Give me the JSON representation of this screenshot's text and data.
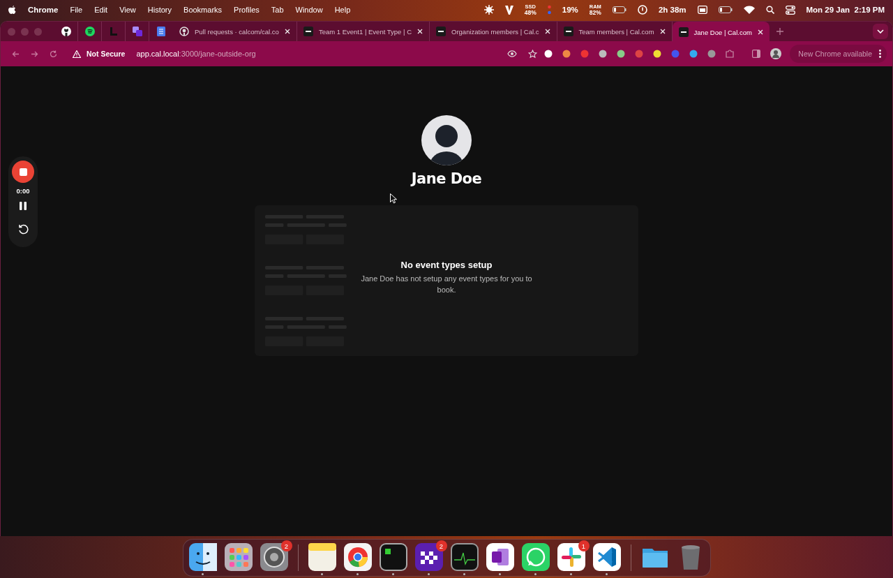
{
  "menubar": {
    "app": "Chrome",
    "menus": [
      "File",
      "Edit",
      "View",
      "History",
      "Bookmarks",
      "Profiles",
      "Tab",
      "Window",
      "Help"
    ],
    "ssd_label": "SSD",
    "ssd": "48%",
    "cpu": "19%",
    "ram_label": "RAM",
    "ram": "82%",
    "battery_time": "2h 38m",
    "clock": "Mon 29 Jan  2:19 PM"
  },
  "tabs": [
    {
      "kind": "pinned",
      "selected": false
    },
    {
      "kind": "pinned",
      "selected": false
    },
    {
      "kind": "pinned",
      "selected": false
    },
    {
      "kind": "pinned",
      "selected": false
    },
    {
      "kind": "pinned",
      "selected": false
    },
    {
      "kind": "tab",
      "title": "Pull requests · calcom/cal.co",
      "selected": false
    },
    {
      "kind": "tab",
      "title": "Team 1 Event1 | Event Type | C",
      "selected": false
    },
    {
      "kind": "tab",
      "title": "Organization members | Cal.c",
      "selected": false
    },
    {
      "kind": "tab",
      "title": "Team members | Cal.com",
      "selected": false
    },
    {
      "kind": "tab",
      "title": "Jane Doe | Cal.com",
      "selected": true
    }
  ],
  "address_bar": {
    "security": "Not Secure",
    "host": "app.cal.local",
    "path": ":3000/jane-outside-org",
    "update": "New Chrome available"
  },
  "recorder": {
    "time": "0:00"
  },
  "profile": {
    "name": "Jane Doe",
    "empty_title": "No event types setup",
    "empty_message": "Jane Doe has not setup any event types for you to book."
  },
  "dock": [
    {
      "kind": "finder",
      "running": true
    },
    {
      "kind": "launchpad",
      "running": false
    },
    {
      "kind": "settings",
      "badge": "2",
      "running": false
    },
    {
      "kind": "separator"
    },
    {
      "kind": "notes",
      "running": true
    },
    {
      "kind": "chrome",
      "running": true
    },
    {
      "kind": "terminal",
      "running": true
    },
    {
      "kind": "checker",
      "badge": "2",
      "running": true
    },
    {
      "kind": "monitor",
      "running": true
    },
    {
      "kind": "notebook",
      "running": true
    },
    {
      "kind": "chat",
      "running": true
    },
    {
      "kind": "slack",
      "badge": "1",
      "running": true
    },
    {
      "kind": "code",
      "running": true
    },
    {
      "kind": "separator"
    },
    {
      "kind": "folder",
      "running": false
    },
    {
      "kind": "trash",
      "running": false
    }
  ]
}
